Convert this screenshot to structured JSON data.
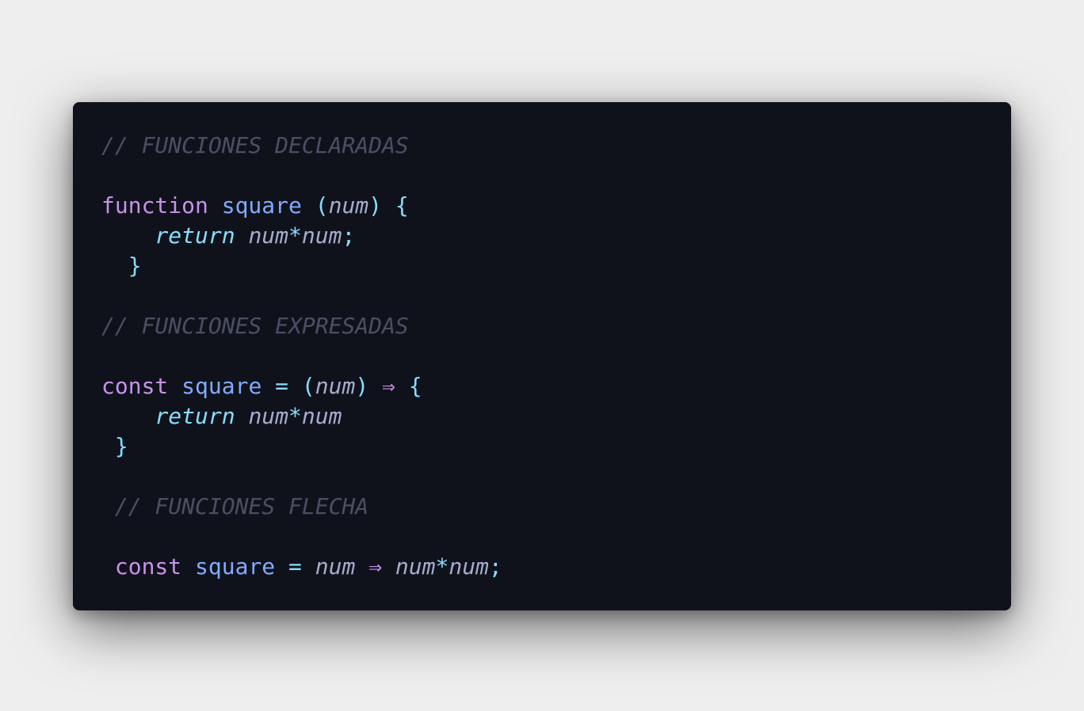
{
  "code": {
    "language": "javascript",
    "lines": [
      [
        {
          "t": "// FUNCIONES DECLARADAS",
          "k": "comment"
        }
      ],
      [],
      [
        {
          "t": "function",
          "k": "kw"
        },
        {
          "t": " ",
          "k": "ws"
        },
        {
          "t": "square",
          "k": "fn"
        },
        {
          "t": " ",
          "k": "ws"
        },
        {
          "t": "(",
          "k": "punc"
        },
        {
          "t": "num",
          "k": "param"
        },
        {
          "t": ")",
          "k": "punc"
        },
        {
          "t": " ",
          "k": "ws"
        },
        {
          "t": "{",
          "k": "punc"
        }
      ],
      [
        {
          "t": "    ",
          "k": "ws"
        },
        {
          "t": "return",
          "k": "ret"
        },
        {
          "t": " ",
          "k": "ws"
        },
        {
          "t": "num",
          "k": "id"
        },
        {
          "t": "*",
          "k": "op"
        },
        {
          "t": "num",
          "k": "id"
        },
        {
          "t": ";",
          "k": "punc"
        }
      ],
      [
        {
          "t": "  ",
          "k": "ws"
        },
        {
          "t": "}",
          "k": "punc"
        }
      ],
      [],
      [
        {
          "t": "// FUNCIONES EXPRESADAS",
          "k": "comment"
        }
      ],
      [],
      [
        {
          "t": "const",
          "k": "kw"
        },
        {
          "t": " ",
          "k": "ws"
        },
        {
          "t": "square",
          "k": "fn"
        },
        {
          "t": " ",
          "k": "ws"
        },
        {
          "t": "=",
          "k": "op"
        },
        {
          "t": " ",
          "k": "ws"
        },
        {
          "t": "(",
          "k": "punc"
        },
        {
          "t": "num",
          "k": "param"
        },
        {
          "t": ")",
          "k": "punc"
        },
        {
          "t": " ",
          "k": "ws"
        },
        {
          "t": "⇒",
          "k": "arrow"
        },
        {
          "t": " ",
          "k": "ws"
        },
        {
          "t": "{",
          "k": "punc"
        }
      ],
      [
        {
          "t": "    ",
          "k": "ws"
        },
        {
          "t": "return",
          "k": "ret"
        },
        {
          "t": " ",
          "k": "ws"
        },
        {
          "t": "num",
          "k": "id"
        },
        {
          "t": "*",
          "k": "op"
        },
        {
          "t": "num",
          "k": "id"
        }
      ],
      [
        {
          "t": " ",
          "k": "ws"
        },
        {
          "t": "}",
          "k": "punc"
        }
      ],
      [],
      [
        {
          "t": " ",
          "k": "ws"
        },
        {
          "t": "// FUNCIONES FLECHA",
          "k": "comment"
        }
      ],
      [],
      [
        {
          "t": " ",
          "k": "ws"
        },
        {
          "t": "const",
          "k": "kw"
        },
        {
          "t": " ",
          "k": "ws"
        },
        {
          "t": "square",
          "k": "fn"
        },
        {
          "t": " ",
          "k": "ws"
        },
        {
          "t": "=",
          "k": "op"
        },
        {
          "t": " ",
          "k": "ws"
        },
        {
          "t": "num",
          "k": "id"
        },
        {
          "t": " ",
          "k": "ws"
        },
        {
          "t": "⇒",
          "k": "arrow"
        },
        {
          "t": " ",
          "k": "ws"
        },
        {
          "t": "num",
          "k": "id"
        },
        {
          "t": "*",
          "k": "op"
        },
        {
          "t": "num",
          "k": "id"
        },
        {
          "t": ";",
          "k": "punc"
        }
      ]
    ]
  },
  "colors": {
    "page_background": "#eeeeee",
    "editor_background": "#10121b",
    "comment": "#4a4f63",
    "keyword": "#c792ea",
    "function_name": "#82aaff",
    "punctuation": "#89ddff",
    "identifier": "#a6accd"
  }
}
